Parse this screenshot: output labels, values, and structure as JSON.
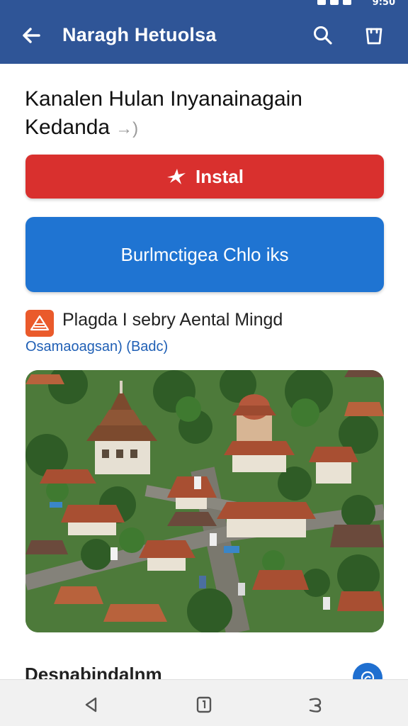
{
  "status": {
    "time": "9:50"
  },
  "appbar": {
    "title": "Naragh Hetuolsa",
    "back_icon": "arrow-left-icon",
    "search_icon": "search-icon",
    "bag_icon": "shopping-bag-icon",
    "color": "#2f5597"
  },
  "app": {
    "name_line1": "Kanalen Hulan Inyanainagain",
    "name_line2": "Kedanda",
    "name_suffix": "→)",
    "install_label": "Instal",
    "install_icon": "spark-icon",
    "install_color": "#d9302e",
    "secondary_label": "Burlmctigea Chlo iks",
    "secondary_color": "#1f74d2",
    "developer": "Plagda I sebry Aental Mingd",
    "developer_sub": "Osamaoagsan) (Badc)"
  },
  "section": {
    "title": "Desnabindalnm"
  },
  "navbar": {
    "back_icon": "nav-back-icon",
    "home_icon": "nav-home-icon",
    "recents_icon": "nav-recents-icon"
  }
}
